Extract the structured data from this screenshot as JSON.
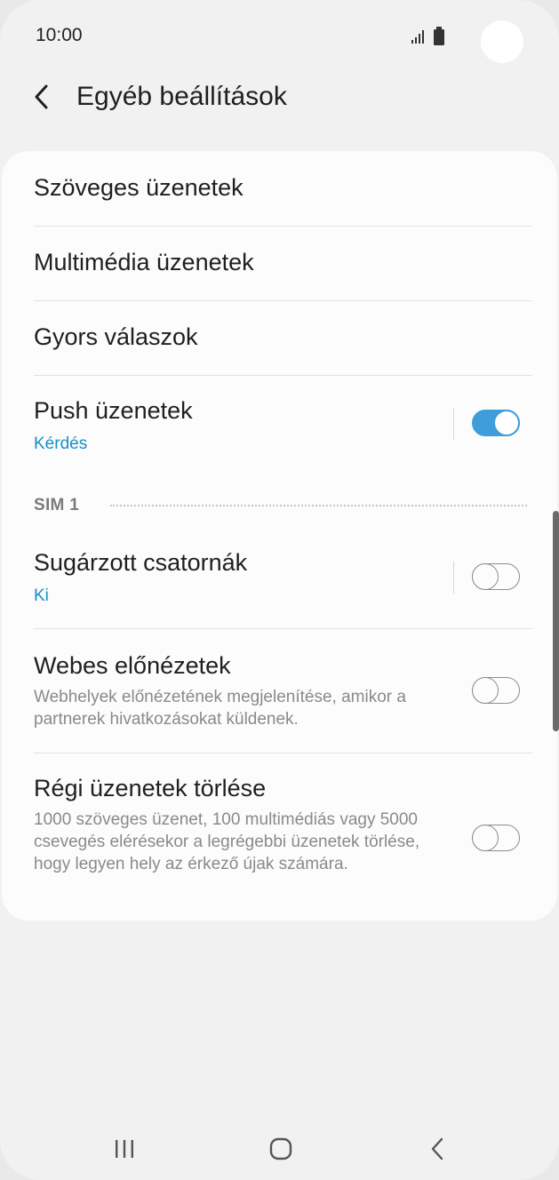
{
  "status_bar": {
    "time": "10:00"
  },
  "header": {
    "title": "Egyéb beállítások"
  },
  "menu": {
    "text_messages": "Szöveges üzenetek",
    "multimedia_messages": "Multimédia üzenetek",
    "quick_responses": "Gyors válaszok"
  },
  "push": {
    "title": "Push üzenetek",
    "subtitle": "Kérdés",
    "enabled": true
  },
  "section": {
    "sim_label": "SIM 1"
  },
  "broadcast": {
    "title": "Sugárzott csatornák",
    "subtitle": "Ki",
    "enabled": false
  },
  "web_preview": {
    "title": "Webes előnézetek",
    "description": "Webhelyek előnézetének megjelenítése, amikor a partnerek hivatkozásokat küldenek.",
    "enabled": false
  },
  "delete_old": {
    "title": "Régi üzenetek törlése",
    "description": "1000 szöveges üzenet, 100 multimédiás vagy 5000 csevegés elérésekor a legrégebbi üzenetek törlése, hogy legyen hely az érkező újak számára.",
    "enabled": false
  },
  "colors": {
    "accent": "#3e9ed9",
    "subtitle_blue": "#1590c4",
    "background": "#f1f1f1",
    "card": "#fcfcfc"
  },
  "icons": {
    "back": "chevron-left-icon",
    "signal": "signal-icon",
    "battery": "battery-icon",
    "nav_recents": "recents-icon",
    "nav_home": "home-icon",
    "nav_back": "back-icon"
  }
}
